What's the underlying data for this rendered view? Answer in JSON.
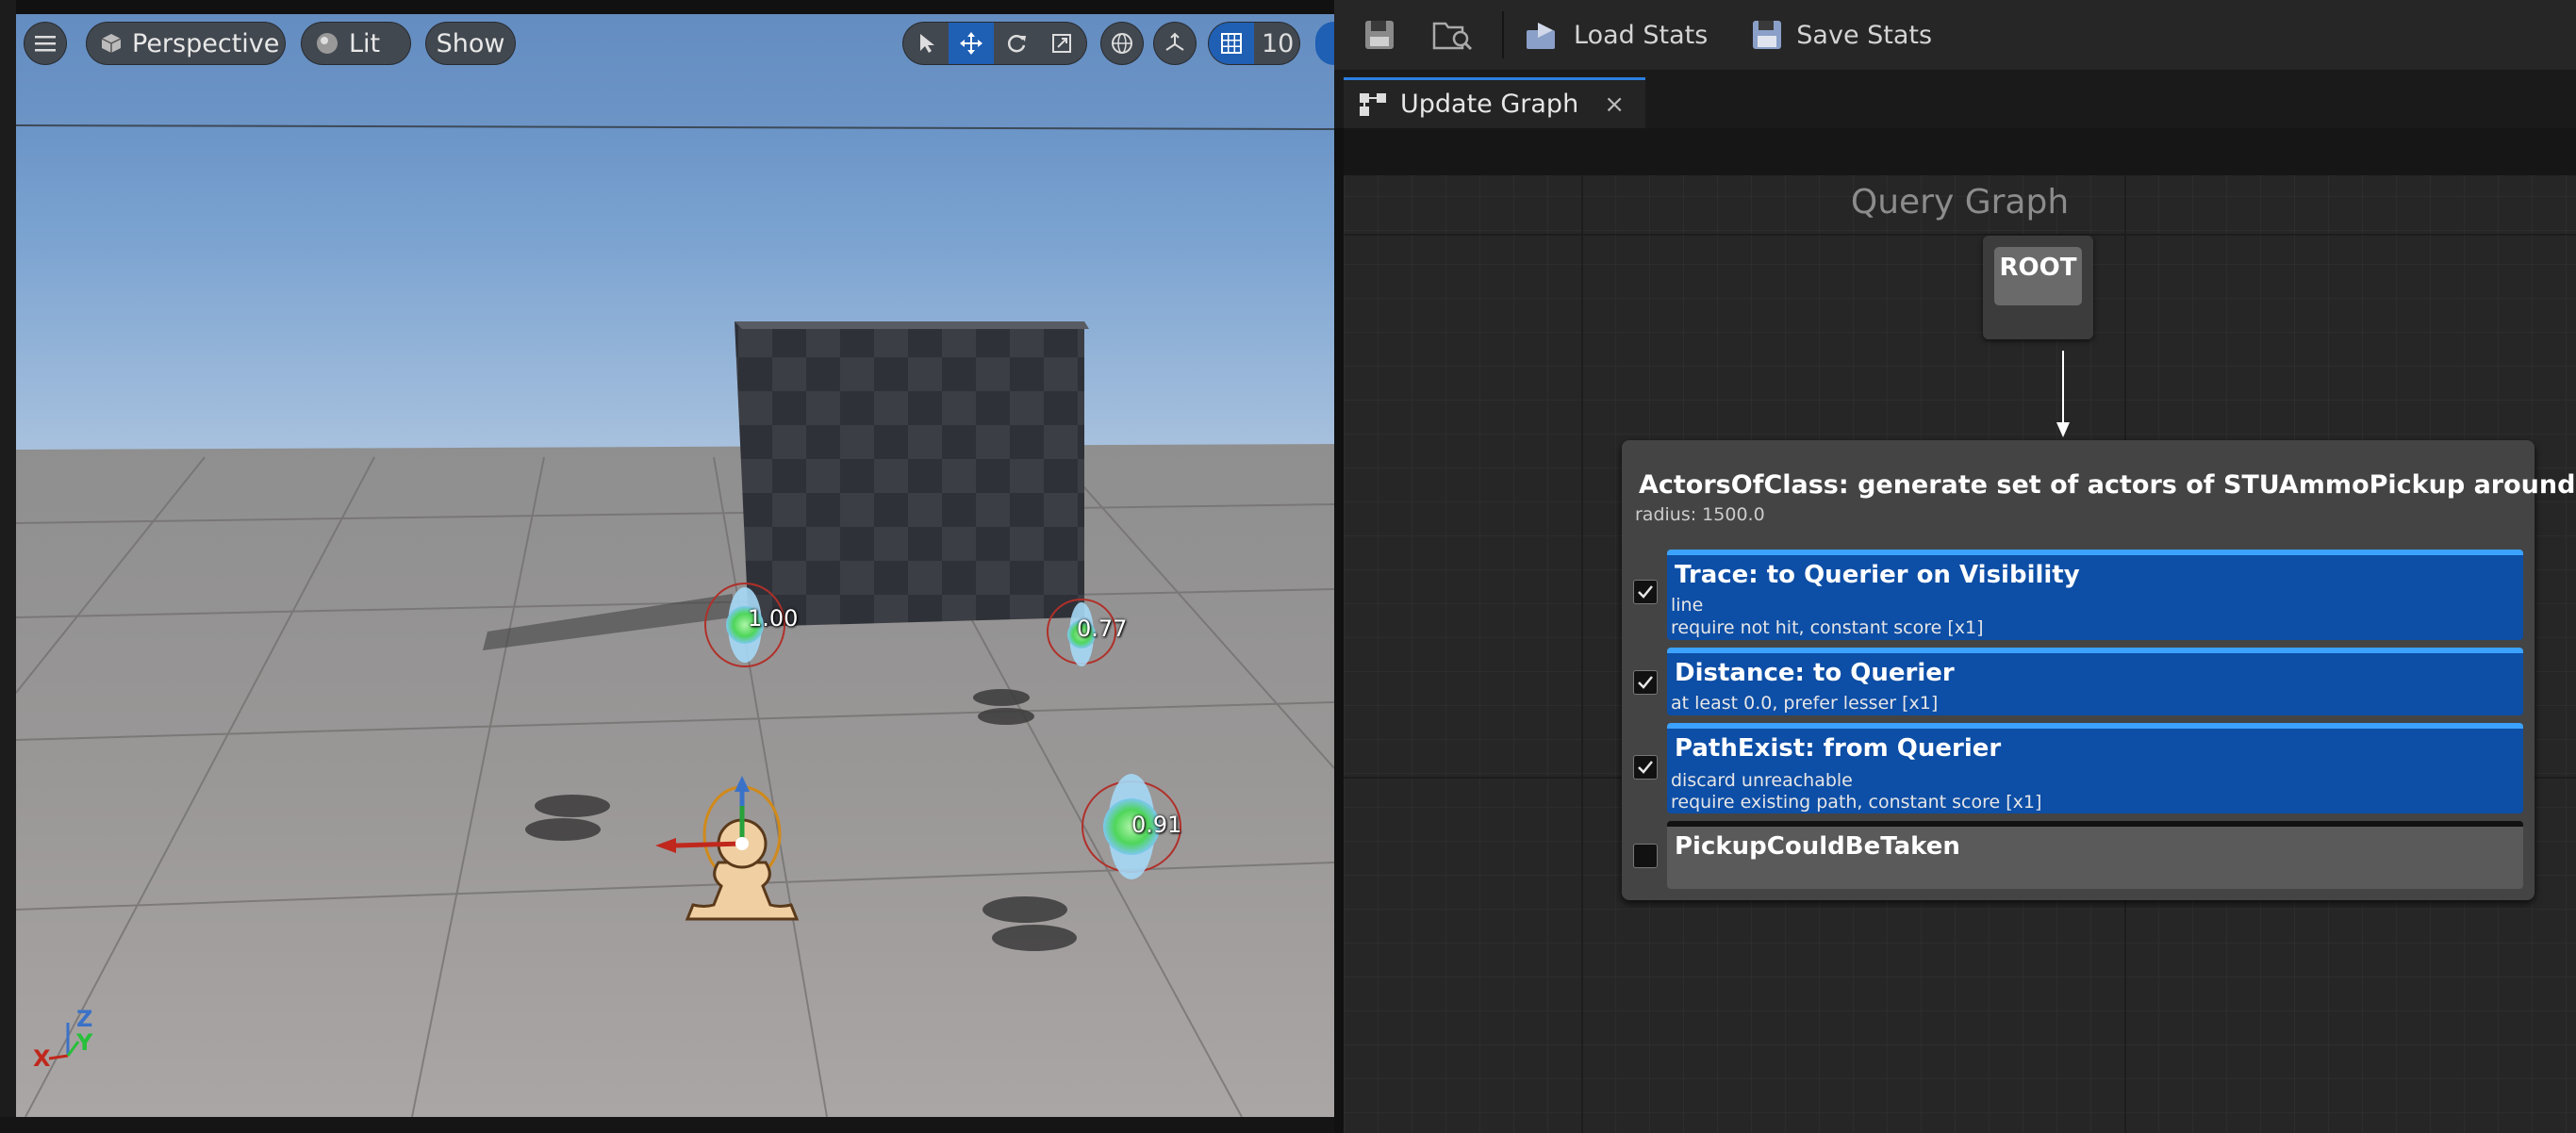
{
  "viewport": {
    "menu_icon": "hamburger-icon",
    "view_mode": "Perspective",
    "lighting_mode": "Lit",
    "show_label": "Show",
    "grid_snap_value": "10",
    "scores": [
      "1.00",
      "0.77",
      "0.91"
    ],
    "axis": {
      "x": "X",
      "y": "Y",
      "z": "Z"
    }
  },
  "toolbar": {
    "save_icon": "save-icon",
    "browse_icon": "browse-icon",
    "load_stats_label": "Load Stats",
    "save_stats_label": "Save Stats"
  },
  "tab": {
    "label": "Update Graph",
    "close": "×"
  },
  "graph": {
    "title": "Query Graph",
    "root_label": "ROOT",
    "generator": {
      "title": "ActorsOfClass: generate set of actors of STUAmmoPickup around Querier",
      "subtitle": "radius: 1500.0"
    },
    "tests": [
      {
        "title": "Trace: to Querier on Visibility",
        "lines": [
          "line",
          "require not hit, constant score [x1]"
        ],
        "enabled": true
      },
      {
        "title": "Distance: to Querier",
        "lines": [
          "at least 0.0, prefer lesser [x1]"
        ],
        "enabled": true
      },
      {
        "title": "PathExist: from Querier",
        "lines": [
          "discard unreachable",
          "require existing path, constant score [x1]"
        ],
        "enabled": true
      },
      {
        "title": "PickupCouldBeTaken",
        "lines": [],
        "enabled": false
      }
    ]
  },
  "colors": {
    "accent": "#2b7fe0",
    "test_enabled": "#0d4ea6",
    "test_disabled": "#5a5a5a"
  }
}
